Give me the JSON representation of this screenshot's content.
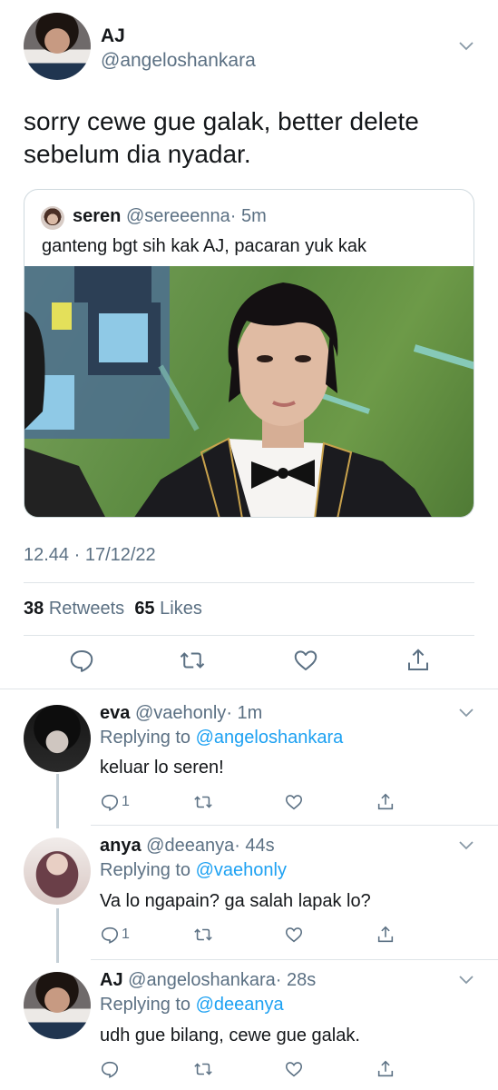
{
  "main_tweet": {
    "name": "AJ",
    "handle": "@angeloshankara",
    "text": "sorry cewe gue galak, better delete sebelum dia nyadar.",
    "quote": {
      "name": "seren",
      "handle": "@sereeenna",
      "time": "· 5m",
      "text": "ganteng bgt sih kak AJ, pacaran yuk kak"
    },
    "timestamp": "12.44 · 17/12/22",
    "retweets_count": "38",
    "retweets_label": "Retweets",
    "likes_count": "65",
    "likes_label": "Likes"
  },
  "replies": [
    {
      "name": "eva",
      "handle": "@vaehonly",
      "time": "· 1m",
      "replying_prefix": "Replying to",
      "replying_to": "@angeloshankara",
      "text": "keluar lo seren!",
      "reply_count": "1"
    },
    {
      "name": "anya",
      "handle": "@deeanya",
      "time": "· 44s",
      "replying_prefix": "Replying to",
      "replying_to": "@vaehonly",
      "text": "Va lo ngapain? ga salah lapak lo?",
      "reply_count": "1"
    },
    {
      "name": "AJ",
      "handle": "@angeloshankara",
      "time": "· 28s",
      "replying_prefix": "Replying to",
      "replying_to": "@deeanya",
      "text": "udh gue bilang, cewe gue galak.",
      "reply_count": ""
    }
  ],
  "colors": {
    "text": "#14171a",
    "secondary": "#5b7083",
    "accent": "#1da1f2",
    "border": "#cfd9de"
  },
  "icons": [
    "chevron-down-icon",
    "reply-icon",
    "retweet-icon",
    "like-icon",
    "share-icon"
  ]
}
